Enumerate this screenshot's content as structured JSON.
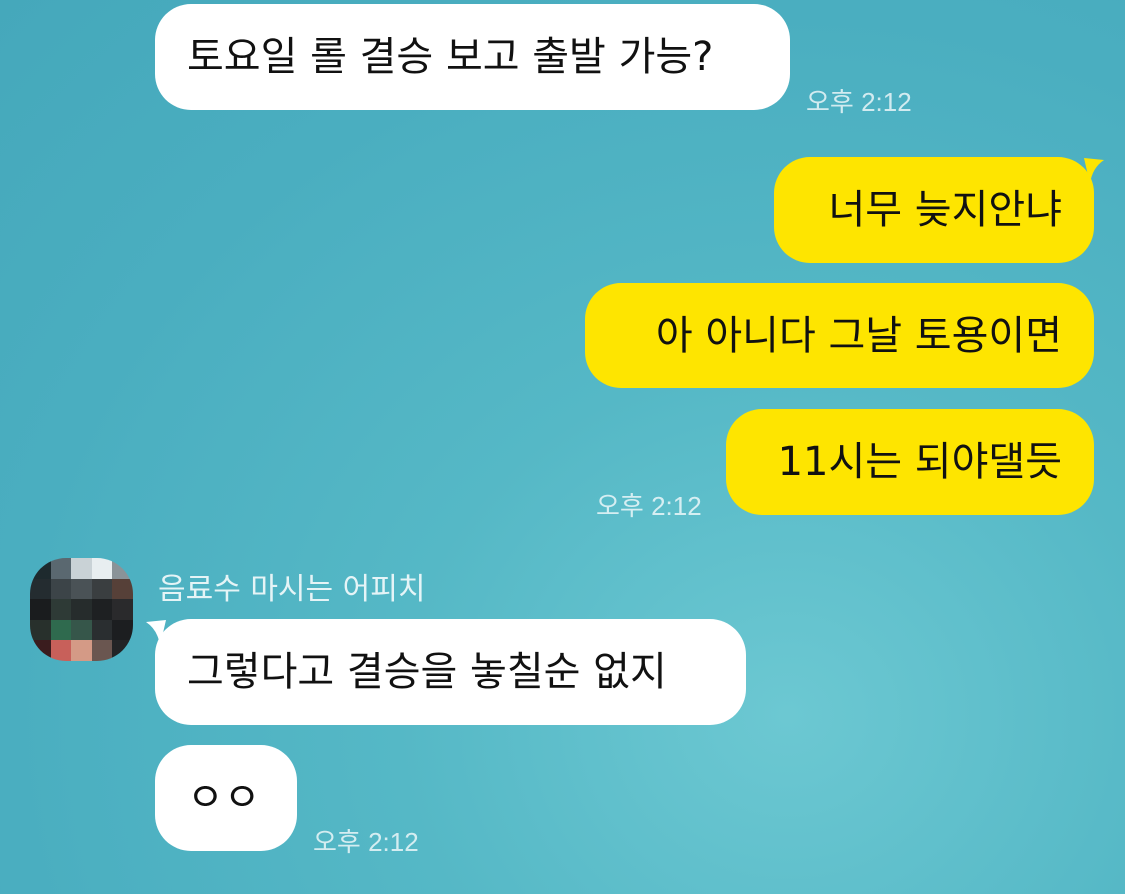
{
  "messages": {
    "m1": {
      "text": "토요일 롤 결승 보고 출발 가능?",
      "time": "오후 2:12"
    },
    "m2": {
      "text": "너무 늦지안냐"
    },
    "m3": {
      "text": "아 아니다 그날 토용이면"
    },
    "m4": {
      "text": "11시는 되야댈듯",
      "time": "오후 2:12"
    },
    "sender_name": "음료수 마시는 어피치",
    "m5": {
      "text": "그렇다고 결승을 놓칠순 없지"
    },
    "m6": {
      "text": "ㅇㅇ",
      "time": "오후 2:12"
    }
  },
  "colors": {
    "background": "#4aaec0",
    "incoming_bubble": "#ffffff",
    "outgoing_bubble": "#fee500"
  },
  "avatar": {
    "image": "pixelated-profile-photo"
  }
}
